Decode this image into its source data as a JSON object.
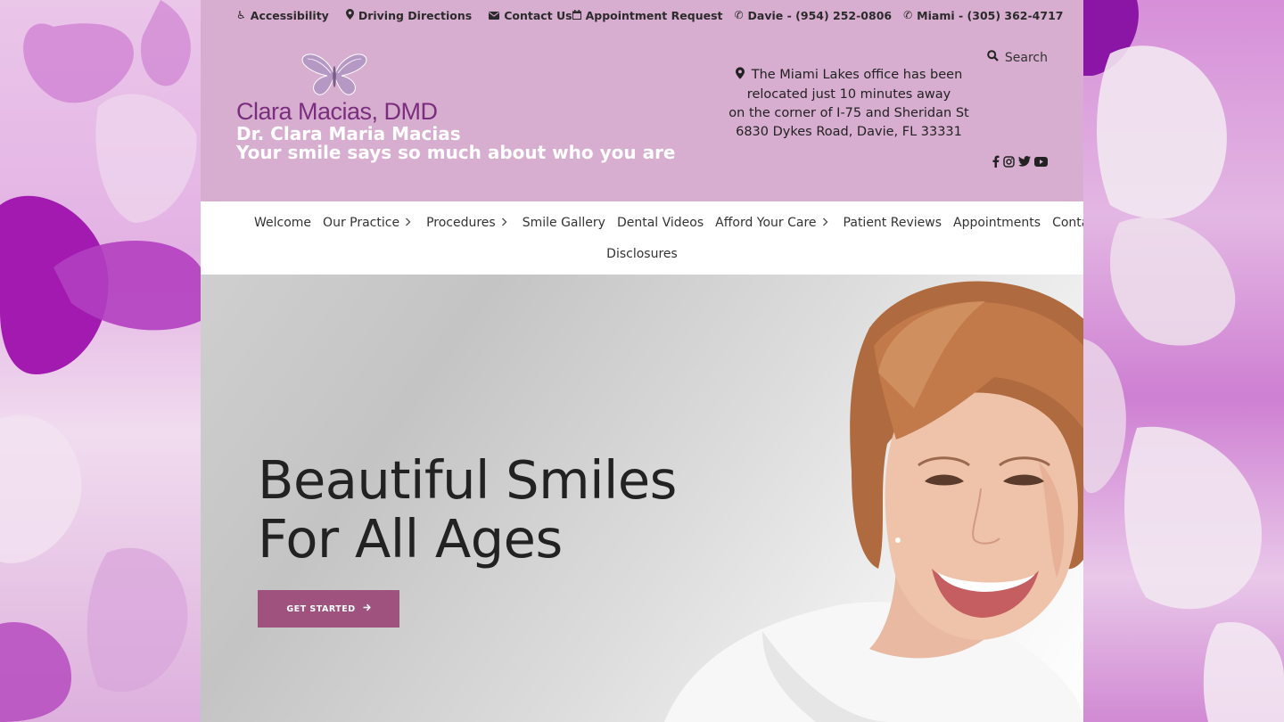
{
  "topbar": {
    "accessibility": "Accessibility",
    "directions": "Driving Directions",
    "contact": "Contact Us",
    "appointment": "Appointment Request",
    "davie_phone": "Davie - (954) 252-0806",
    "miami_phone": "Miami - (305) 362-4717"
  },
  "logo": {
    "name": "Clara Macias, DMD",
    "doctor": "Dr. Clara Maria Macias",
    "tagline": "Your smile says so much about who you are"
  },
  "notice": {
    "line1": "The Miami Lakes office has been",
    "line2": "relocated just 10 minutes away",
    "line3": "on the corner of I-75 and Sheridan St",
    "line4": "6830 Dykes Road, Davie, FL 33331"
  },
  "search": {
    "label": "Search"
  },
  "social": [
    "facebook-icon",
    "instagram-icon",
    "twitter-icon",
    "youtube-icon"
  ],
  "nav": {
    "items": [
      {
        "label": "Welcome",
        "has_sub": false
      },
      {
        "label": "Our Practice",
        "has_sub": true
      },
      {
        "label": "Procedures",
        "has_sub": true
      },
      {
        "label": "Smile Gallery",
        "has_sub": false
      },
      {
        "label": "Dental Videos",
        "has_sub": false
      },
      {
        "label": "Afford Your Care",
        "has_sub": true
      },
      {
        "label": "Patient Reviews",
        "has_sub": false
      },
      {
        "label": "Appointments",
        "has_sub": false
      },
      {
        "label": "Contact",
        "has_sub": false
      }
    ],
    "second_row": "Disclosures"
  },
  "hero": {
    "title_line1": "Beautiful Smiles",
    "title_line2": "For All Ages",
    "cta": "GET STARTED"
  },
  "colors": {
    "header_bg": "#d8aed0",
    "brand_purple": "#7a2e7e",
    "cta_bg": "#a0527e"
  }
}
